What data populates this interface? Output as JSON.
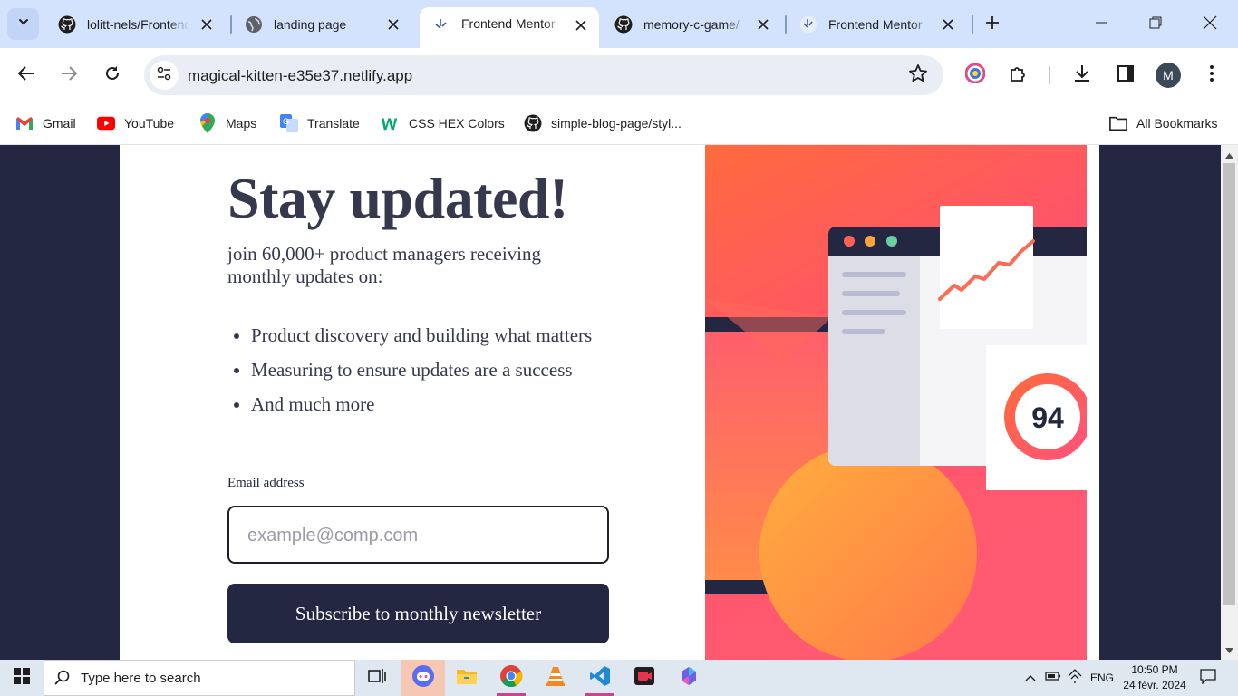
{
  "browser": {
    "tabs": [
      {
        "title": "lolitt-nels/Frontend-Mentor",
        "icon": "github-icon",
        "active": false
      },
      {
        "title": "landing page",
        "icon": "globe-icon",
        "active": false
      },
      {
        "title": "Frontend Mentor",
        "icon": "frontend-mentor-icon",
        "active": true
      },
      {
        "title": "memory-c-game/",
        "icon": "github-icon",
        "active": false
      },
      {
        "title": "Frontend Mentor",
        "icon": "frontend-mentor-icon",
        "active": false
      }
    ],
    "url": "magical-kitten-e35e37.netlify.app",
    "profile_initial": "M",
    "bookmarks": [
      {
        "label": "Gmail",
        "icon": "gmail-icon"
      },
      {
        "label": "YouTube",
        "icon": "youtube-icon"
      },
      {
        "label": "Maps",
        "icon": "maps-icon"
      },
      {
        "label": "Translate",
        "icon": "translate-icon"
      },
      {
        "label": "CSS HEX Colors",
        "icon": "w3schools-icon"
      },
      {
        "label": "simple-blog-page/styl...",
        "icon": "github-icon"
      }
    ],
    "all_bookmarks_label": "All Bookmarks"
  },
  "page": {
    "headline": "Stay updated!",
    "intro": "join 60,000+ product managers receiving monthly updates on:",
    "bullets": [
      "Product discovery and building what matters",
      "Measuring to ensure updates are a success",
      "And much more"
    ],
    "email_label": "Email address",
    "email_placeholder": "example@comp.com",
    "submit_label": "Subscribe to monthly newsletter",
    "score": "94",
    "colors": {
      "navy": "#242742",
      "charcoal": "#36384d",
      "tomato": "#ff6155"
    }
  },
  "taskbar": {
    "search_placeholder": "Type here to search",
    "language": "ENG",
    "time": "10:50 PM",
    "date": "24 févr. 2024"
  }
}
